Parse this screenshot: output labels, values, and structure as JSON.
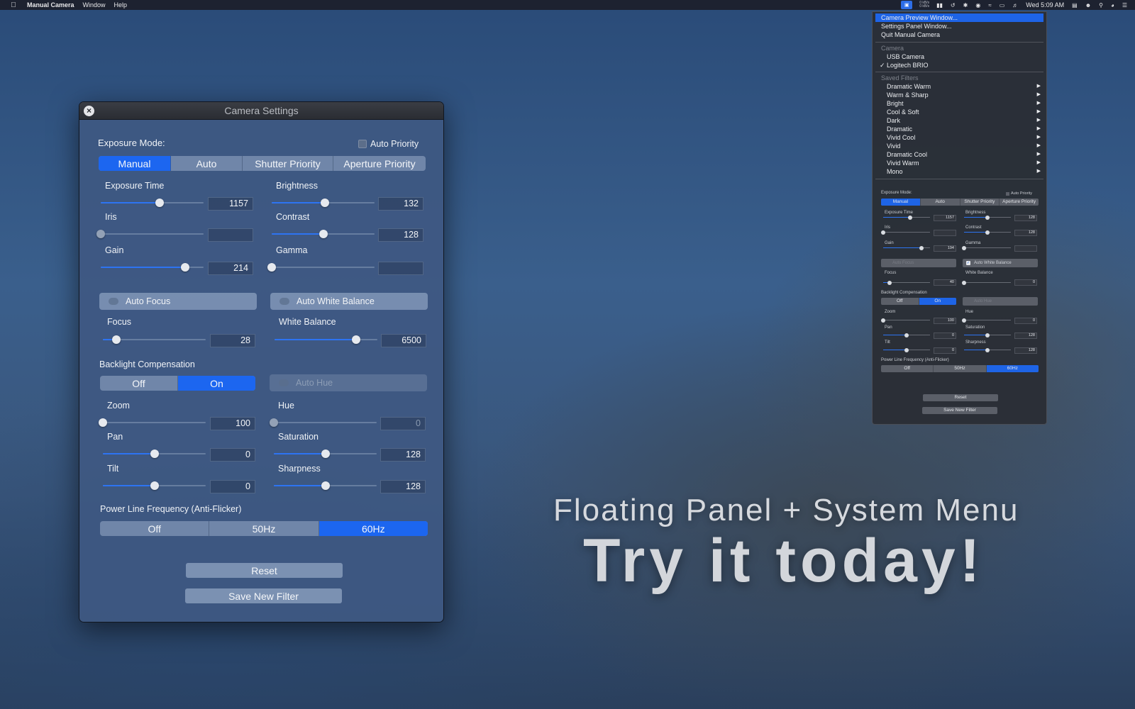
{
  "menubar": {
    "app_name": "Manual Camera",
    "menus": [
      "Window",
      "Help"
    ],
    "clock": "Wed 5:09 AM",
    "net_up": "0 kB/s",
    "net_down": "0 kB/s"
  },
  "window": {
    "title": "Camera Settings",
    "exposure_mode_label": "Exposure Mode:",
    "auto_priority_label": "Auto Priority",
    "auto_priority_checked": false,
    "exposure_modes": [
      "Manual",
      "Auto",
      "Shutter Priority",
      "Aperture Priority"
    ],
    "selected_exposure_mode": "Manual",
    "controls": {
      "exposure_time": {
        "label": "Exposure Time",
        "value": "1157",
        "level": 0.57
      },
      "brightness": {
        "label": "Brightness",
        "value": "132",
        "level": 0.52
      },
      "iris": {
        "label": "Iris",
        "value": "",
        "level": 0.0
      },
      "contrast": {
        "label": "Contrast",
        "value": "128",
        "level": 0.5
      },
      "gain": {
        "label": "Gain",
        "value": "214",
        "level": 0.82
      },
      "gamma": {
        "label": "Gamma",
        "value": "",
        "level": 0.0
      },
      "focus": {
        "label": "Focus",
        "value": "28",
        "level": 0.13
      },
      "white_balance": {
        "label": "White Balance",
        "value": "6500",
        "level": 0.79
      },
      "zoom": {
        "label": "Zoom",
        "value": "100",
        "level": 0.0
      },
      "hue": {
        "label": "Hue",
        "value": "0",
        "level": 0.0
      },
      "pan": {
        "label": "Pan",
        "value": "0",
        "level": 0.5
      },
      "saturation": {
        "label": "Saturation",
        "value": "128",
        "level": 0.5
      },
      "tilt": {
        "label": "Tilt",
        "value": "0",
        "level": 0.5
      },
      "sharpness": {
        "label": "Sharpness",
        "value": "128",
        "level": 0.5
      }
    },
    "auto_focus_label": "Auto Focus",
    "auto_white_balance_label": "Auto White Balance",
    "auto_hue_label": "Auto Hue",
    "backlight_label": "Backlight Compensation",
    "backlight_options": [
      "Off",
      "On"
    ],
    "backlight_selected": "On",
    "power_line_label": "Power Line Frequency (Anti-Flicker)",
    "power_line_options": [
      "Off",
      "50Hz",
      "60Hz"
    ],
    "power_line_selected": "60Hz",
    "reset_label": "Reset",
    "save_filter_label": "Save New Filter"
  },
  "dropdown": {
    "actions": [
      "Camera Preview Window...",
      "Settings Panel Window...",
      "Quit Manual Camera"
    ],
    "highlighted": "Camera Preview Window...",
    "camera_header": "Camera",
    "cameras": [
      "USB Camera",
      "Logitech BRIO"
    ],
    "selected_camera": "Logitech BRIO",
    "filters_header": "Saved Filters",
    "filters": [
      "Dramatic Warm",
      "Warm & Sharp",
      "Bright",
      "Cool & Soft",
      "Dark",
      "Dramatic",
      "Vivid Cool",
      "Vivid",
      "Dramatic Cool",
      "Vivid Warm",
      "Mono"
    ],
    "mini": {
      "exposure_mode_label": "Exposure Mode:",
      "auto_priority_label": "Auto Priority",
      "exposure_time": "1157",
      "brightness": "128",
      "contrast": "128",
      "gain": "194",
      "focus": "40",
      "white_balance": "0",
      "zoom": "100",
      "hue": "0",
      "pan": "0",
      "saturation": "128",
      "tilt": "0",
      "sharpness": "128",
      "auto_white_balance_checked": true
    }
  },
  "promo": {
    "subtitle": "Floating Panel + System Menu",
    "headline": "Try it today!"
  },
  "colors": {
    "accent": "#1c66f0",
    "menu_highlight": "#1e64e6"
  }
}
